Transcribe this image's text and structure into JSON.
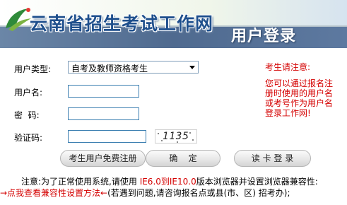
{
  "banner": {
    "title": "云南省招生考试工作网",
    "subtitle": "用户登录"
  },
  "form": {
    "user_type_label": "用户类型:",
    "user_type_value": "自考及教师资格考生",
    "username_label": "用户名:",
    "password_label": "密  码:",
    "captcha_label": "验证码:",
    "captcha_image_text": "1135"
  },
  "notice": {
    "title": "考生请注意:",
    "body": "您可以通过报名注册时使用的用户名或考号作为用户名登录工作网!"
  },
  "buttons": {
    "register": "考生用户免费注册",
    "confirm": "确    定",
    "card_login": "读 卡 登 录"
  },
  "footer": {
    "line1_prefix": "注意:为了正常使用系统,请使用 ",
    "line1_highlight": "IE6.0到IE10.0",
    "line1_suffix": "版本浏览器并设置浏览器兼容性:",
    "line2_link": "→点我查看兼容性设置方法←",
    "line2_suffix": "(若遇到问题,请咨询报名点或县(市、区) 招考办);"
  },
  "colors": {
    "banner_title": "#1e4f8c",
    "notice_red": "#d40000",
    "input_border": "#3c7fb1"
  }
}
